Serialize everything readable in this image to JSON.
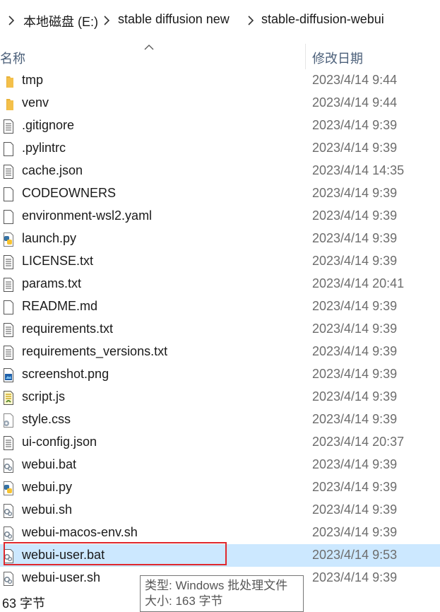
{
  "breadcrumb": {
    "prefix": "ī",
    "items": [
      "本地磁盘 (E:)",
      "stable diffusion new",
      "stable-diffusion-webui"
    ]
  },
  "columns": {
    "name": "名称",
    "date": "修改日期"
  },
  "files": [
    {
      "name": "tmp",
      "date": "2023/4/14 9:44",
      "icon": "folder-icon"
    },
    {
      "name": "venv",
      "date": "2023/4/14 9:44",
      "icon": "folder-icon"
    },
    {
      "name": ".gitignore",
      "date": "2023/4/14 9:39",
      "icon": "text-file-icon"
    },
    {
      "name": ".pylintrc",
      "date": "2023/4/14 9:39",
      "icon": "blank-file-icon"
    },
    {
      "name": "cache.json",
      "date": "2023/4/14 14:35",
      "icon": "text-file-icon"
    },
    {
      "name": "CODEOWNERS",
      "date": "2023/4/14 9:39",
      "icon": "blank-file-icon"
    },
    {
      "name": "environment-wsl2.yaml",
      "date": "2023/4/14 9:39",
      "icon": "blank-file-icon"
    },
    {
      "name": "launch.py",
      "date": "2023/4/14 9:39",
      "icon": "python-file-icon"
    },
    {
      "name": "LICENSE.txt",
      "date": "2023/4/14 9:39",
      "icon": "text-file-icon"
    },
    {
      "name": "params.txt",
      "date": "2023/4/14 20:41",
      "icon": "text-file-icon"
    },
    {
      "name": "README.md",
      "date": "2023/4/14 9:39",
      "icon": "blank-file-icon"
    },
    {
      "name": "requirements.txt",
      "date": "2023/4/14 9:39",
      "icon": "text-file-icon"
    },
    {
      "name": "requirements_versions.txt",
      "date": "2023/4/14 9:39",
      "icon": "text-file-icon"
    },
    {
      "name": "screenshot.png",
      "date": "2023/4/14 9:39",
      "icon": "image-file-icon"
    },
    {
      "name": "script.js",
      "date": "2023/4/14 9:39",
      "icon": "script-file-icon"
    },
    {
      "name": "style.css",
      "date": "2023/4/14 9:39",
      "icon": "css-file-icon"
    },
    {
      "name": "ui-config.json",
      "date": "2023/4/14 20:37",
      "icon": "text-file-icon"
    },
    {
      "name": "webui.bat",
      "date": "2023/4/14 9:39",
      "icon": "batch-file-icon"
    },
    {
      "name": "webui.py",
      "date": "2023/4/14 9:39",
      "icon": "python-file-icon"
    },
    {
      "name": "webui.sh",
      "date": "2023/4/14 9:39",
      "icon": "batch-file-icon"
    },
    {
      "name": "webui-macos-env.sh",
      "date": "2023/4/14 9:39",
      "icon": "batch-file-icon"
    },
    {
      "name": "webui-user.bat",
      "date": "2023/4/14 9:53",
      "icon": "batch-file-icon",
      "selected": true
    },
    {
      "name": "webui-user.sh",
      "date": "2023/4/14 9:39",
      "icon": "batch-file-icon"
    }
  ],
  "tooltip": {
    "type": "类型: Windows 批处理文件",
    "size": "大小: 163 字节"
  },
  "status": {
    "items_text": "63 字节"
  },
  "colors": {
    "selection": "#cce8ff",
    "highlight": "#e0282d",
    "folder": "#f4c04a"
  }
}
